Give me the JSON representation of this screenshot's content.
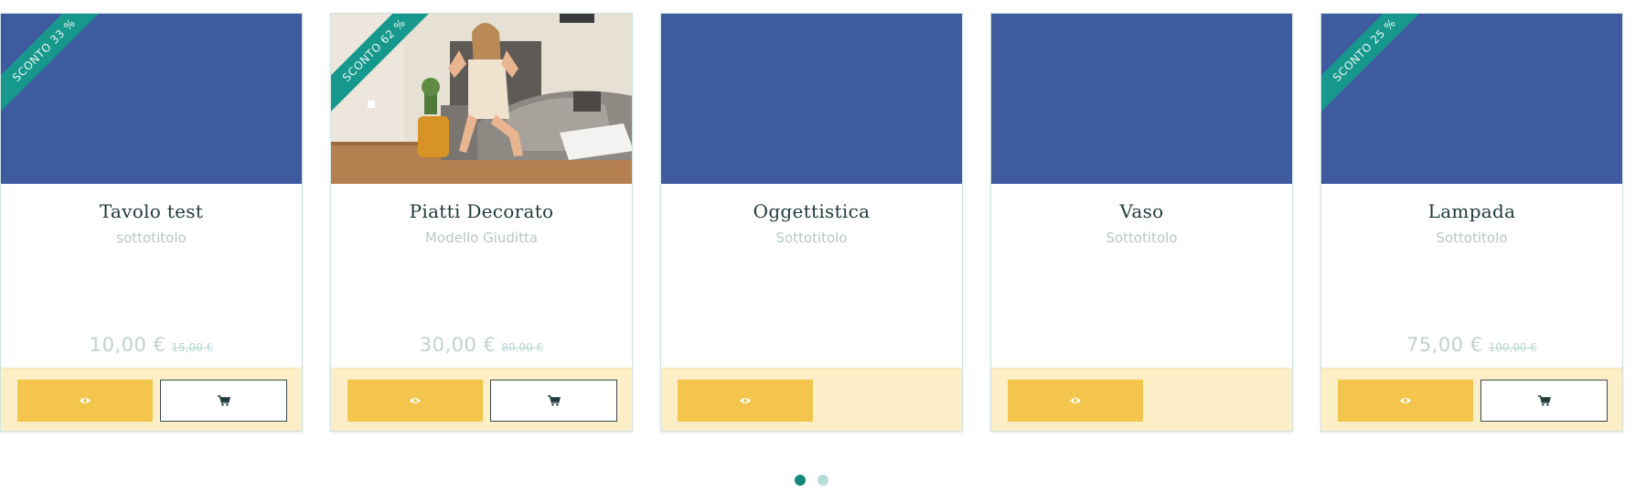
{
  "products": [
    {
      "title": "Tavolo test",
      "subtitle": "sottotitolo",
      "discount": "SCONTO 33 %",
      "price": "10,00 €",
      "old_price": "15,00 €",
      "has_cart": true,
      "image": "placeholder"
    },
    {
      "title": "Piatti Decorato",
      "subtitle": "Modello Giuditta",
      "discount": "SCONTO 62 %",
      "price": "30,00 €",
      "old_price": "80,00 €",
      "has_cart": true,
      "image": "photo-woman-bedroom"
    },
    {
      "title": "Oggettistica",
      "subtitle": "Sottotitolo",
      "discount": "",
      "price": "",
      "old_price": "",
      "has_cart": false,
      "image": "placeholder"
    },
    {
      "title": "Vaso",
      "subtitle": "Sottotitolo",
      "discount": "",
      "price": "",
      "old_price": "",
      "has_cart": false,
      "image": "placeholder"
    },
    {
      "title": "Lampada",
      "subtitle": "Sottotitolo",
      "discount": "SCONTO 25 %",
      "price": "75,00 €",
      "old_price": "100,00 €",
      "has_cart": true,
      "image": "placeholder"
    }
  ],
  "icons": {
    "view": "eye-icon",
    "cart": "cart-icon"
  },
  "pagination": {
    "pages": 2,
    "active": 1
  },
  "colors": {
    "placeholder_image": "#3f5ba0",
    "ribbon": "#16988c",
    "action_bar": "#fcefc7",
    "view_button": "#f4c54c",
    "dot_active": "#16877d",
    "dot_inactive": "#b6dcd7"
  }
}
